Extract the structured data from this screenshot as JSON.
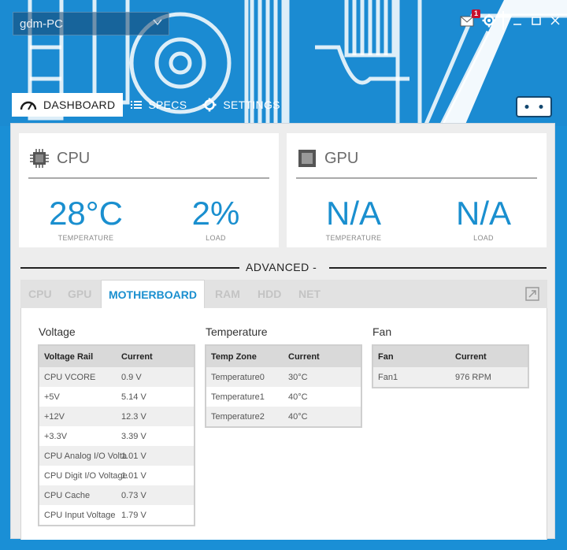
{
  "header": {
    "pc_name": "gdm-PC",
    "mail_badge": "1"
  },
  "tabs": [
    {
      "label": "DASHBOARD",
      "icon": "speedometer-icon"
    },
    {
      "label": "SPECS",
      "icon": "list-icon"
    },
    {
      "label": "SETTINGS",
      "icon": "gear-icon"
    }
  ],
  "cpu": {
    "title": "CPU",
    "temperature": "28°C",
    "temperature_label": "TEMPERATURE",
    "load": "2%",
    "load_label": "LOAD"
  },
  "gpu": {
    "title": "GPU",
    "temperature": "N/A",
    "temperature_label": "TEMPERATURE",
    "load": "N/A",
    "load_label": "LOAD"
  },
  "advanced": {
    "label": "ADVANCED -",
    "tabs": [
      "CPU",
      "GPU",
      "MOTHERBOARD",
      "RAM",
      "HDD",
      "NET"
    ]
  },
  "voltage": {
    "title": "Voltage",
    "headers": [
      "Voltage Rail",
      "Current"
    ],
    "rows": [
      [
        "CPU VCORE",
        "0.9 V"
      ],
      [
        "+5V",
        "5.14 V"
      ],
      [
        "+12V",
        "12.3 V"
      ],
      [
        "+3.3V",
        "3.39 V"
      ],
      [
        "CPU Analog I/O Volta",
        "1.01 V"
      ],
      [
        "CPU Digit I/O Voltage",
        "1.01 V"
      ],
      [
        "CPU Cache",
        "0.73 V"
      ],
      [
        "CPU Input Voltage",
        "1.79 V"
      ]
    ]
  },
  "temperature": {
    "title": "Temperature",
    "headers": [
      "Temp Zone",
      "Current"
    ],
    "rows": [
      [
        "Temperature0",
        "30°C"
      ],
      [
        "Temperature1",
        "40°C"
      ],
      [
        "Temperature2",
        "40°C"
      ]
    ]
  },
  "fan": {
    "title": "Fan",
    "headers": [
      "Fan",
      "Current"
    ],
    "rows": [
      [
        "Fan1",
        "976 RPM"
      ]
    ]
  },
  "colors": {
    "accent": "#1a8fcf",
    "header_bg": "#1b8bd2",
    "badge": "#c8102e"
  }
}
